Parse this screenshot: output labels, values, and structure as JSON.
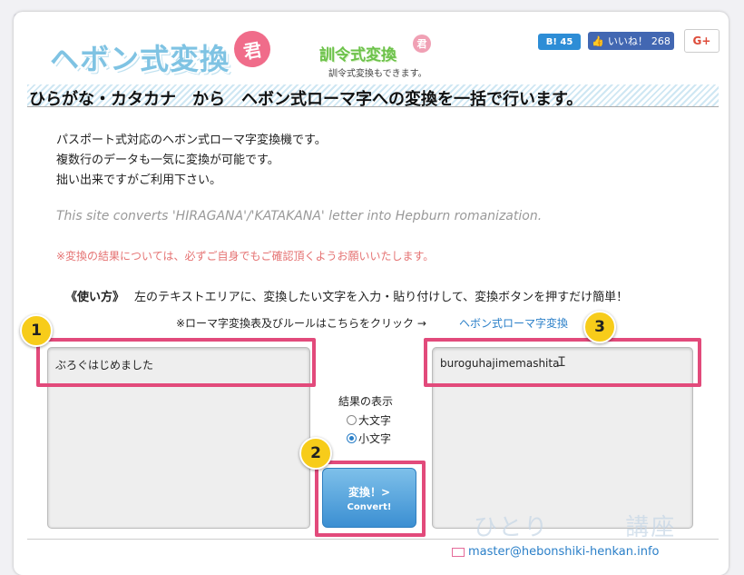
{
  "header": {
    "logo_main": "ヘボン式変換",
    "logo_badge": "君",
    "logo_sub": "訓令式変換",
    "logo_sub_badge": "君",
    "logo_subtitle": "訓令式変換もできます。",
    "social": {
      "hatena_label": "B! 45",
      "fb_like_label": "いいね！",
      "fb_like_count": "268",
      "gplus_label": "G+"
    }
  },
  "headline": "ひらがな・カタカナ　から　ヘボン式ローマ字への変換を一括で行います。",
  "intro_lines": [
    "パスポート式対応のヘボン式ローマ字変換機です。",
    "複数行のデータも一気に変換が可能です。",
    "拙い出来ですがご利用下さい。"
  ],
  "english_note": "This site converts 'HIRAGANA'/'KATAKANA' letter into Hepburn romanization.",
  "warning": "※変換の結果については、必ずご自身でもご確認頂くようお願いいたします。",
  "usage": {
    "heading": "《使い方》",
    "text": "左のテキストエリアに、変換したい文字を入力・貼り付けして、変換ボタンを押すだけ簡単！"
  },
  "table_note": "※ローマ字変換表及びルールはこちらをクリック →",
  "table_link": "ヘボン式ローマ字変換",
  "input_text": "ぶろぐはじめました",
  "output_text": "buroguhajimemashita",
  "result_display": {
    "label": "結果の表示",
    "options": [
      {
        "label": "大文字",
        "checked": false
      },
      {
        "label": "小文字",
        "checked": true
      }
    ]
  },
  "convert_button": {
    "line1": "変換！>",
    "line2": "Convert!"
  },
  "markers": [
    "1",
    "2",
    "3"
  ],
  "watermark": "ひとり　　　講座",
  "footer_email": "master@hebonshiki-henkan.info",
  "colors": {
    "highlight": "#e24a7b",
    "marker": "#f7cc1a",
    "button": "#3b8fd2",
    "link": "#2a7fc8"
  }
}
